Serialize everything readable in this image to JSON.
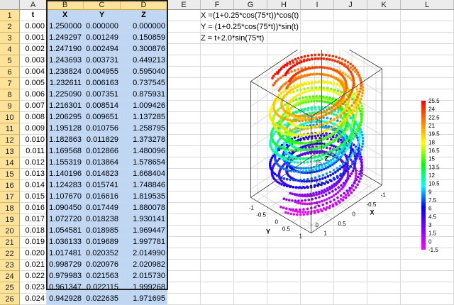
{
  "columns": [
    "A",
    "B",
    "C",
    "D",
    "E",
    "F",
    "G",
    "H",
    "I",
    "J",
    "K",
    "L"
  ],
  "selected_columns": [
    "B",
    "C",
    "D"
  ],
  "header_row": [
    "t",
    "X",
    "Y",
    "Z"
  ],
  "rows": [
    [
      "0.000",
      "1.250000",
      "0.000000",
      "0.000000"
    ],
    [
      "0.001",
      "1.249297",
      "0.001249",
      "0.150859"
    ],
    [
      "0.002",
      "1.247190",
      "0.002494",
      "0.300876"
    ],
    [
      "0.003",
      "1.243693",
      "0.003731",
      "0.449213"
    ],
    [
      "0.004",
      "1.238824",
      "0.004955",
      "0.595040"
    ],
    [
      "0.005",
      "1.232611",
      "0.006163",
      "0.737545"
    ],
    [
      "0.006",
      "1.225090",
      "0.007351",
      "0.875931"
    ],
    [
      "0.007",
      "1.216301",
      "0.008514",
      "1.009426"
    ],
    [
      "0.008",
      "1.206295",
      "0.009651",
      "1.137285"
    ],
    [
      "0.009",
      "1.195128",
      "0.010756",
      "1.258795"
    ],
    [
      "0.010",
      "1.182863",
      "0.011829",
      "1.373278"
    ],
    [
      "0.011",
      "1.169568",
      "0.012866",
      "1.480096"
    ],
    [
      "0.012",
      "1.155319",
      "0.013864",
      "1.578654"
    ],
    [
      "0.013",
      "1.140196",
      "0.014823",
      "1.668404"
    ],
    [
      "0.014",
      "1.124283",
      "0.015741",
      "1.748846"
    ],
    [
      "0.015",
      "1.107670",
      "0.016616",
      "1.819535"
    ],
    [
      "0.016",
      "1.090450",
      "0.017449",
      "1.880078"
    ],
    [
      "0.017",
      "1.072720",
      "0.018238",
      "1.930141"
    ],
    [
      "0.018",
      "1.054581",
      "0.018985",
      "1.969447"
    ],
    [
      "0.019",
      "1.036133",
      "0.019689",
      "1.997781"
    ],
    [
      "0.020",
      "1.017481",
      "0.020352",
      "2.014990"
    ],
    [
      "0.021",
      "0.998729",
      "0.020976",
      "2.020982"
    ],
    [
      "0.022",
      "0.979983",
      "0.021563",
      "2.015730"
    ],
    [
      "0.023",
      "0.961347",
      "0.022115",
      "1.999268"
    ],
    [
      "0.024",
      "0.942928",
      "0.022635",
      "1.971695"
    ]
  ],
  "formulas": [
    "X =(1+0.25*cos(75*t))*cos(t)",
    "Y = (1+0.25*cos(75*t))*sin(t)",
    "Z = t+2.0*sin(75*t)"
  ],
  "colorbar": {
    "ticks": [
      "25.5",
      "24",
      "22.5",
      "21",
      "19.5",
      "18",
      "16.5",
      "15",
      "13.5",
      "12",
      "10.5",
      "9",
      "7.5",
      "6",
      "4.5",
      "3",
      "1.5",
      "0",
      "-1.5"
    ],
    "colors": [
      "#ff0000",
      "#ff8000",
      "#ffff00",
      "#00ff00",
      "#00ffff",
      "#0000ff",
      "#8000ff",
      "#ff00ff"
    ]
  },
  "chart_data": {
    "type": "scatter3d",
    "title": "",
    "x_equation": "X =(1+0.25*cos(75*t))*cos(t)",
    "y_equation": "Y = (1+0.25*cos(75*t))*sin(t)",
    "z_equation": "Z = t+2.0*sin(75*t)",
    "xlabel": "X",
    "ylabel": "Y",
    "zlabel": "Z",
    "x_ticks": [
      "1",
      "0.5",
      "0",
      "-0.5",
      "-1"
    ],
    "y_ticks": [
      "1",
      "0.5",
      "0",
      "-0.5",
      "-1"
    ],
    "z_ticks": [
      "25",
      "20",
      "15",
      "10",
      "5",
      "0"
    ],
    "xlim": [
      -1.25,
      1.25
    ],
    "ylim": [
      -1.25,
      1.25
    ],
    "zlim": [
      -2,
      26
    ],
    "colormap": "rainbow",
    "colorbar_range": [
      -1.5,
      25.5
    ]
  }
}
